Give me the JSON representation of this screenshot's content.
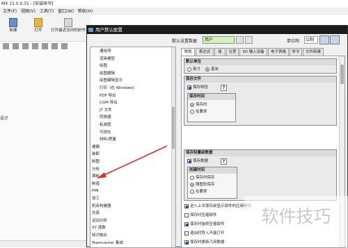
{
  "app": {
    "title": "MX 11.0.0.31 - [安装研书]",
    "menu": [
      "文件(F)",
      "视图(V)",
      "工具(T)",
      "窗口(W)",
      "帮助(H)"
    ],
    "toolbar": [
      {
        "label": "新建",
        "icon": "new-file-icon"
      },
      {
        "label": "打开",
        "icon": "folder-open-icon"
      },
      {
        "label": "打开最近访问的研书",
        "icon": "recent-files-icon"
      }
    ],
    "left_label": "设计"
  },
  "dialog": {
    "title": "用户默认配置",
    "settings_label": "默认设置数据",
    "settings_value": "用户",
    "unit_label": "单位制",
    "unit_value": "公制"
  },
  "tree": {
    "items": [
      {
        "label": "通用项",
        "sub": true
      },
      {
        "label": "渲染模型",
        "sub": true
      },
      {
        "label": "绘图",
        "sub": true
      },
      {
        "label": "绘图编辑",
        "sub": true
      },
      {
        "label": "绘图编辑显示",
        "sub": true
      },
      {
        "label": "打印（在 Windows）",
        "sub": true
      },
      {
        "label": "PDF 导出",
        "sub": true
      },
      {
        "label": "CGM 导出",
        "sub": true
      },
      {
        "label": "JT 文件",
        "sub": true
      },
      {
        "label": "转换器",
        "sub": true
      },
      {
        "label": "标准图",
        "sub": true
      },
      {
        "label": "可视化",
        "sub": true
      },
      {
        "label": "材料/质量",
        "sub": true
      },
      {
        "label": "建模",
        "sub": false
      },
      {
        "label": "装配",
        "sub": false
      },
      {
        "label": "制图",
        "sub": false
      },
      {
        "label": "分析",
        "sub": false
      },
      {
        "label": "满板",
        "sub": false
      },
      {
        "label": "制造",
        "sub": false
      },
      {
        "label": "PMI",
        "sub": false
      },
      {
        "label": "加工",
        "sub": false
      },
      {
        "label": "机床构建器",
        "sub": false
      },
      {
        "label": "仿真",
        "sub": false
      },
      {
        "label": "运动分析",
        "sub": false
      },
      {
        "label": "XY 函数",
        "sub": false
      },
      {
        "label": "知识融合",
        "sub": false
      },
      {
        "label": "Teamcenter 集成",
        "sub": false
      }
    ]
  },
  "tabs": [
    "常规",
    "表达式",
    "组",
    "注意",
    "3D 输入设备",
    "电子表格",
    "命令",
    "文件新建"
  ],
  "panel": {
    "unit_group": {
      "title": "默认单位",
      "options": [
        "英寸",
        "毫米"
      ],
      "selected": 1
    },
    "part_group": {
      "title": "保存文件",
      "keep_checkbox": "保存特性",
      "time_title": "保存时间",
      "time_options": [
        "保存时",
        "在要求"
      ],
      "time_selected": 0
    },
    "light_group": {
      "title": "保存轻量级数据",
      "keep_checkbox": "保存数据",
      "time_title": "创建时间",
      "time_options": [
        "保存时保存",
        "随图形保存",
        "在要求"
      ],
      "time_selected": 1
    },
    "checkboxes": [
      {
        "label": "进入上次保存前显示部件的应用模块",
        "checked": true
      },
      {
        "label": "保存时压缩部件",
        "checked": false
      },
      {
        "label": "保存时始终压缩部件",
        "checked": true
      },
      {
        "label": "退出时导入不能打开",
        "checked": false
      },
      {
        "label": "保存时更新几何数据",
        "checked": true
      }
    ]
  },
  "watermark": "软件技巧"
}
